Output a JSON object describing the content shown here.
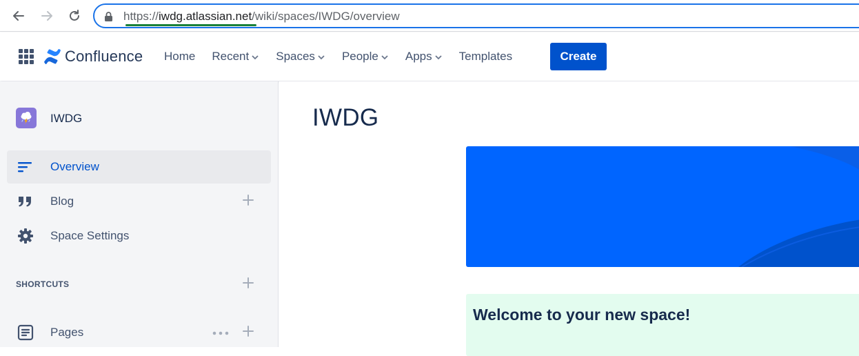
{
  "browser": {
    "url_scheme": "https://",
    "url_host": "iwdg.atlassian.net",
    "url_path": "/wiki/spaces/IWDG/overview"
  },
  "topnav": {
    "app_name": "Confluence",
    "items": [
      {
        "label": "Home",
        "dropdown": false
      },
      {
        "label": "Recent",
        "dropdown": true
      },
      {
        "label": "Spaces",
        "dropdown": true
      },
      {
        "label": "People",
        "dropdown": true
      },
      {
        "label": "Apps",
        "dropdown": true
      },
      {
        "label": "Templates",
        "dropdown": false
      }
    ],
    "create_label": "Create"
  },
  "sidebar": {
    "space_name": "IWDG",
    "items": [
      {
        "label": "Overview",
        "icon": "overview-icon"
      },
      {
        "label": "Blog",
        "icon": "quote-icon"
      },
      {
        "label": "Space Settings",
        "icon": "gear-icon"
      }
    ],
    "shortcuts_label": "SHORTCUTS",
    "pages_label": "Pages"
  },
  "main": {
    "title": "IWDG",
    "welcome_title": "Welcome to your new space!"
  },
  "colors": {
    "brand_blue": "#0052cc",
    "banner_blue": "#0065ff",
    "welcome_bg": "#e3fcef",
    "sidebar_bg": "#f4f5f7",
    "space_avatar": "#8777d9"
  }
}
